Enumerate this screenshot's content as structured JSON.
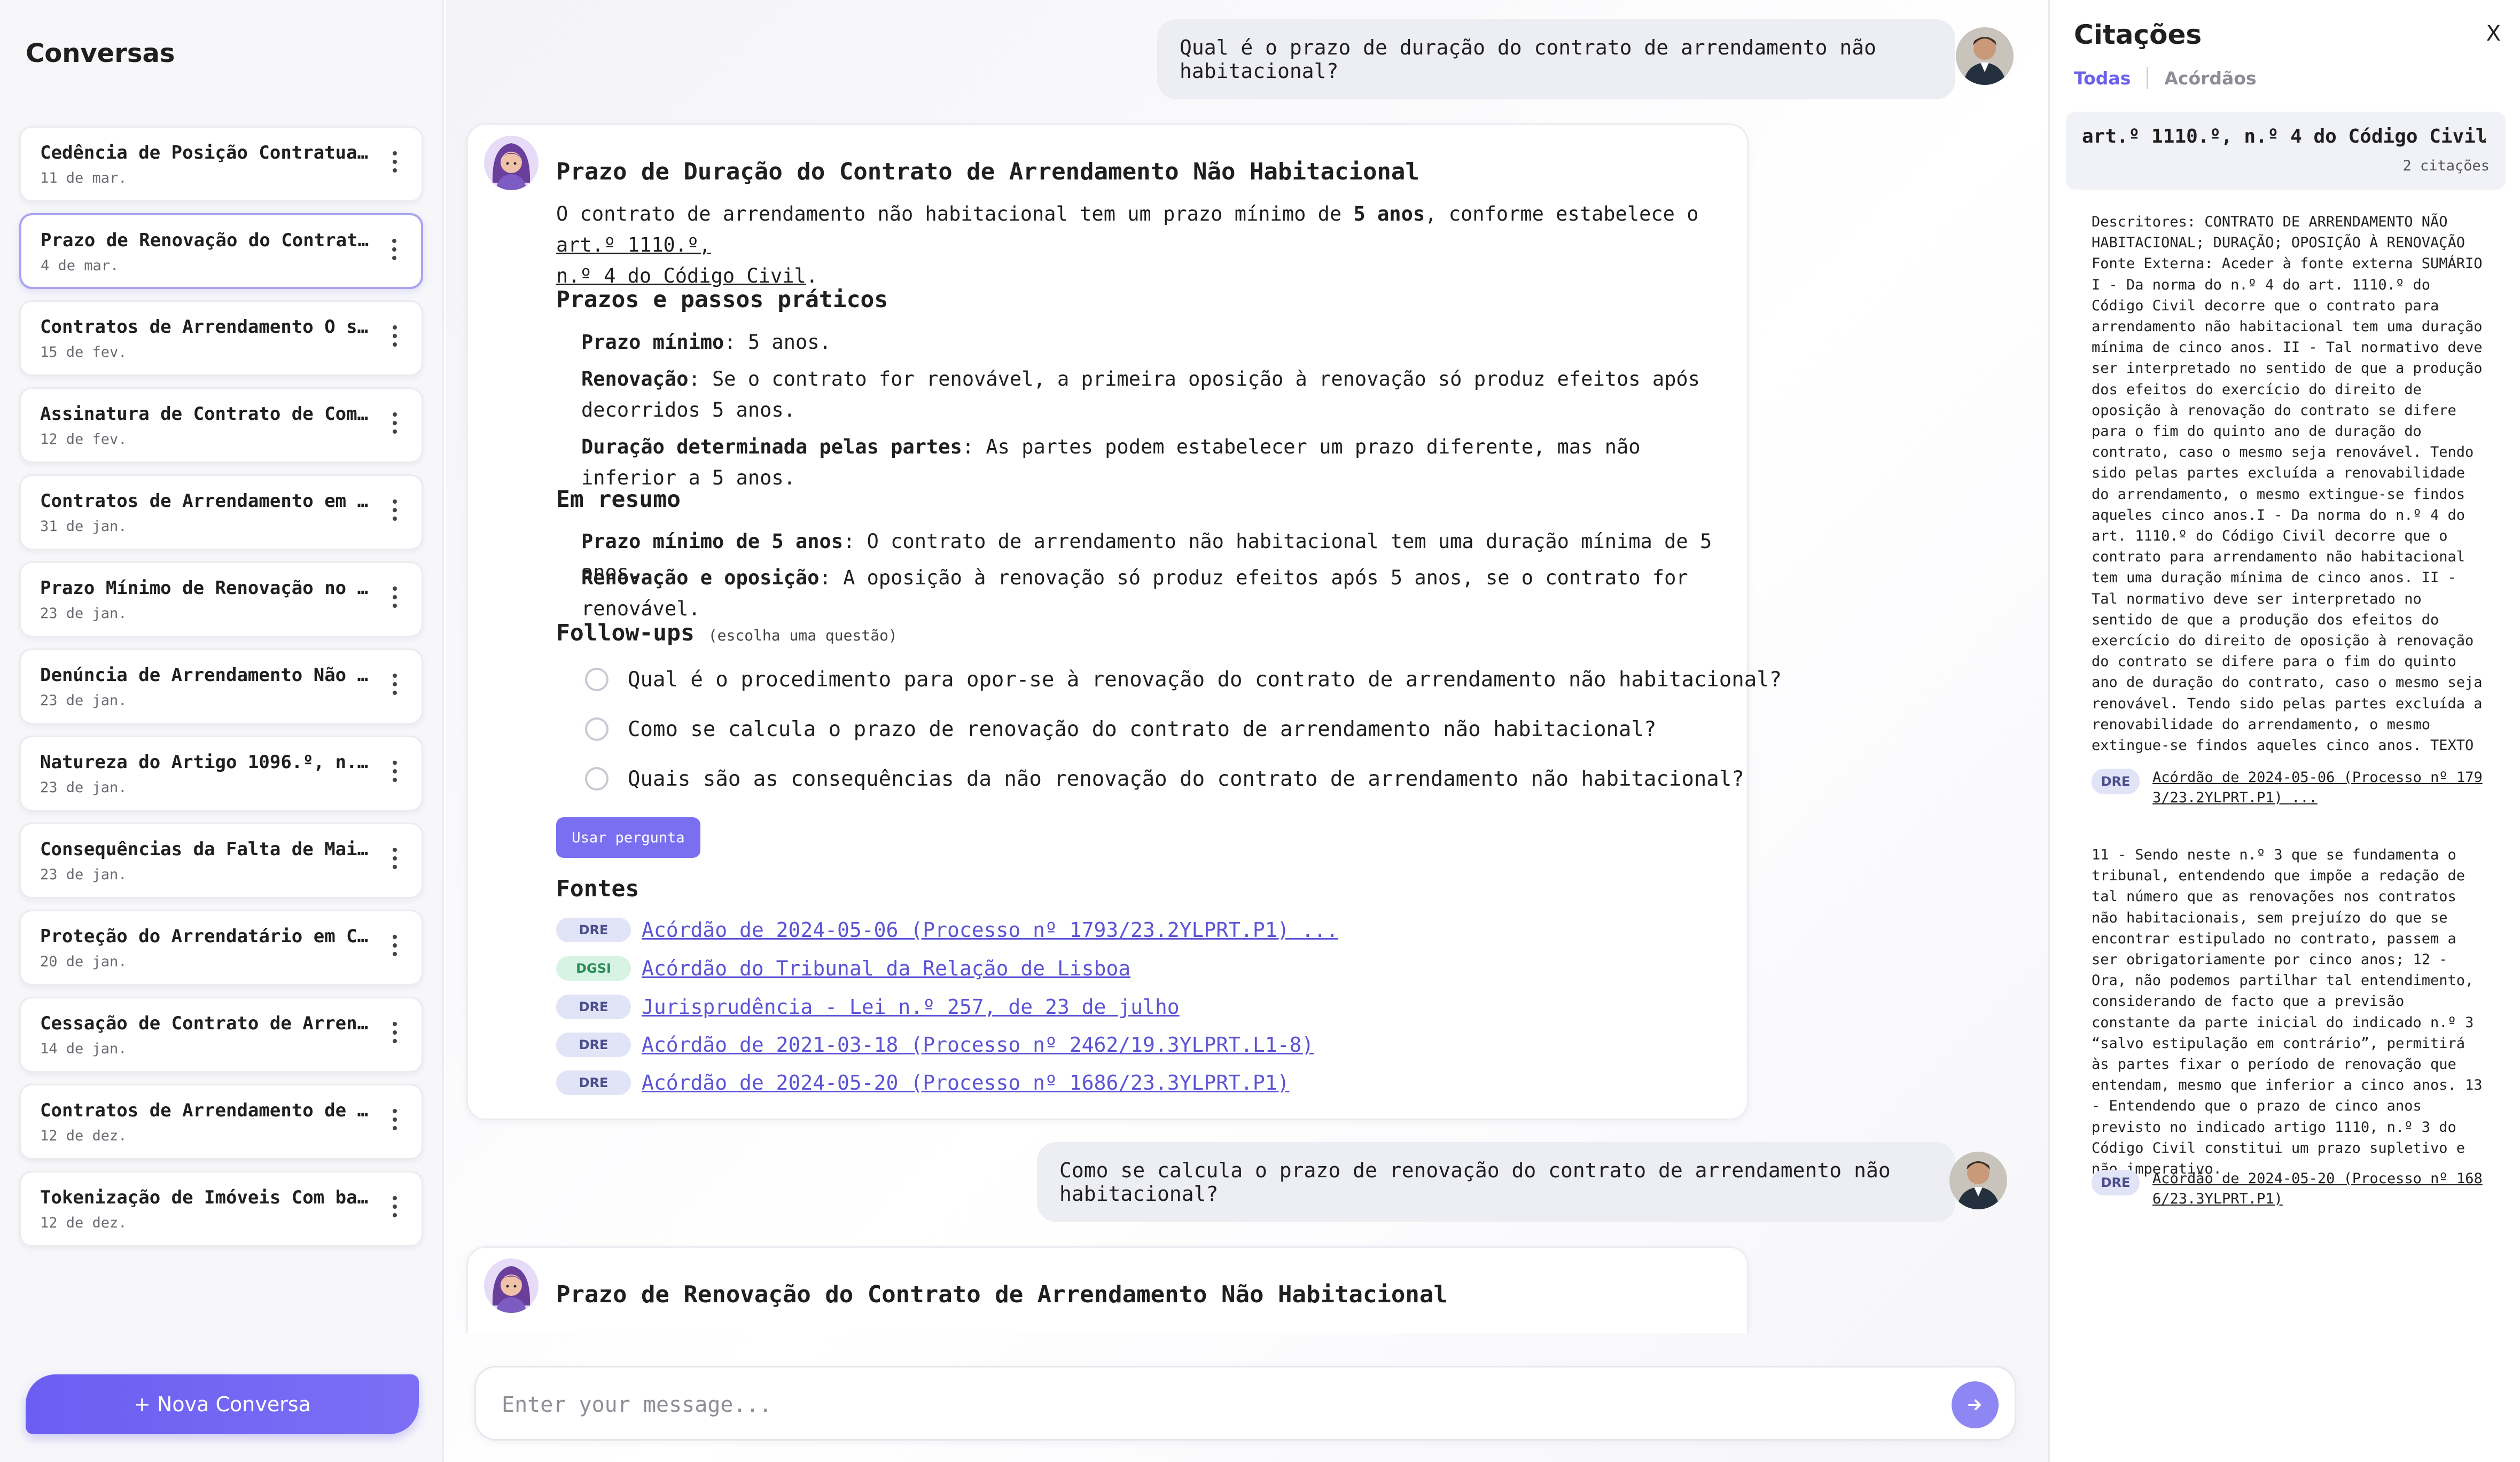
{
  "sidebar": {
    "title": "Conversas",
    "conversations": [
      {
        "title": "Cedência de Posição Contratual ...",
        "date": "11 de mar."
      },
      {
        "title": "Prazo de Renovação do Contrato ...",
        "date": "4 de mar."
      },
      {
        "title": "Contratos de Arrendamento O se...",
        "date": "15 de fev."
      },
      {
        "title": "Assinatura de Contrato de Comp...",
        "date": "12 de fev."
      },
      {
        "title": "Contratos de Arrendamento em P...",
        "date": "31 de jan."
      },
      {
        "title": "Prazo Mínimo de Renovação no A...",
        "date": "23 de jan."
      },
      {
        "title": "Denúncia de Arrendamento Não ...",
        "date": "23 de jan."
      },
      {
        "title": "Natureza do Artigo 1096.º, n.º 1,...",
        "date": "23 de jan."
      },
      {
        "title": "Consequências da Falta de Maior...",
        "date": "23 de jan."
      },
      {
        "title": "Proteção do Arrendatário em Co...",
        "date": "20 de jan."
      },
      {
        "title": "Cessação de Contrato de Arrend...",
        "date": "14 de jan."
      },
      {
        "title": "Contratos de Arrendamento de 2 ...",
        "date": "12 de dez."
      },
      {
        "title": "Tokenização de Imóveis Com bas...",
        "date": "12 de dez."
      }
    ],
    "new_conversation": "+ Nova Conversa"
  },
  "chat": {
    "user_q1": "Qual é o prazo de duração do contrato de arrendamento não habitacional?",
    "resp1": {
      "title": "Prazo de Duração do Contrato de Arrendamento Não Habitacional",
      "intro_a": "O contrato de arrendamento não habitacional tem um prazo mínimo de ",
      "intro_bold": "5 anos",
      "intro_b": ", conforme estabelece o ",
      "intro_link": "art.º 1110.º,",
      "intro_link2": "n.º 4 do Código Civil",
      "intro_end": ".",
      "section1_title": "Prazos e passos práticos",
      "section1_items": [
        {
          "label": "Prazo mínimo",
          "text": ": 5 anos."
        },
        {
          "label": "Renovação",
          "text": ": Se o contrato for renovável, a primeira oposição à renovação só produz efeitos após decorridos 5 anos."
        },
        {
          "label": "Duração determinada pelas partes",
          "text": ": As partes podem estabelecer um prazo diferente, mas não inferior a 5 anos."
        }
      ],
      "section2_title": "Em resumo",
      "section2_items": [
        {
          "label": "Prazo mínimo de 5 anos",
          "text": ": O contrato de arrendamento não habitacional tem uma duração mínima de 5 anos."
        },
        {
          "label": "Renovação e oposição",
          "text": ": A oposição à renovação só produz efeitos após 5 anos, se o contrato for renovável."
        }
      ],
      "followups_title": "Follow-ups",
      "followups_hint": "(escolha uma questão)",
      "followups": [
        "Qual é o procedimento para opor-se à renovação do contrato de arrendamento não habitacional?",
        "Como se calcula o prazo de renovação do contrato de arrendamento não habitacional?",
        "Quais são as consequências da não renovação do contrato de arrendamento não habitacional?"
      ],
      "use_question": "Usar pergunta",
      "sources_title": "Fontes",
      "sources": [
        {
          "badge": "DRE",
          "text": "Acórdão de 2024-05-06 (Processo nº 1793/23.2YLPRT.P1) ..."
        },
        {
          "badge": "DGSI",
          "text": "Acórdão do Tribunal da Relação de Lisboa"
        },
        {
          "badge": "DRE",
          "text": "Jurisprudência - Lei n.º 257, de 23 de julho"
        },
        {
          "badge": "DRE",
          "text": "Acórdão de 2021-03-18 (Processo nº 2462/19.3YLPRT.L1-8)"
        },
        {
          "badge": "DRE",
          "text": "Acórdão de 2024-05-20 (Processo nº 1686/23.3YLPRT.P1)"
        }
      ]
    },
    "user_q2": "Como se calcula o prazo de renovação do contrato de arrendamento não habitacional?",
    "resp2": {
      "title": "Prazo de Renovação do Contrato de Arrendamento Não Habitacional"
    },
    "input_placeholder": "Enter your message..."
  },
  "panel": {
    "title": "Citações",
    "close": "X",
    "tab_all": "Todas",
    "tab_acordaos": "Acórdãos",
    "citation_title": "art.º 1110.º, n.º 4 do Código Civil",
    "citation_count": "2 citações",
    "chevron": "⌄",
    "excerpt1": "Descritores: CONTRATO DE ARRENDAMENTO NÃO HABITACIONAL; DURAÇÃO; OPOSIÇÃO À RENOVAÇÃO Fonte Externa: Aceder à fonte externa SUMÁRIO I - Da norma do n.º 4 do art. 1110.º do Código Civil decorre que o contrato para arrendamento não habitacional tem uma duração mínima de cinco anos. II - Tal normativo deve ser interpretado no sentido de que a produção dos efeitos do exercício do direito de oposição à renovação do contrato se difere para o fim do quinto ano de duração do contrato, caso o mesmo seja renovável. Tendo sido pelas partes excluída a renovabilidade do arrendamento, o mesmo extingue-se findos aqueles cinco anos.I - Da norma do n.º 4 do art. 1110.º do Código Civil decorre que o contrato para arrendamento não habitacional tem uma duração mínima de cinco anos. II - Tal normativo deve ser interpretado no sentido de que a produção dos efeitos do exercício do direito de oposição à renovação do contrato se difere para o fim do quinto ano de duração do contrato, caso o mesmo seja renovável. Tendo sido pelas partes excluída a renovabilidade do arrendamento, o mesmo extingue-se findos aqueles cinco anos. TEXTO",
    "ref1_badge": "DRE",
    "ref1_link": "Acórdão de 2024-05-06 (Processo nº 179 3/23.2YLPRT.P1) ...",
    "excerpt2": "11 - Sendo neste n.º 3 que se fundamenta o tribunal, entendendo que impõe a redação de tal número que as renovações nos contratos não habitacionais, sem prejuízo do que se encontrar estipulado no contrato, passem a ser obrigatoriamente por cinco anos; 12 - Ora, não podemos partilhar tal entendimento, considerando de facto que a previsão constante da parte inicial do indicado n.º 3 “salvo estipulação em contrário”, permitirá às partes fixar o período de renovação que entendam, mesmo que inferior a cinco anos. 13 - Entendendo que o prazo de cinco anos previsto no indicado artigo 1110, n.º 3 do Código Civil constitui um prazo supletivo e não imperativo.",
    "ref2_badge": "DRE",
    "ref2_link": "Acórdão de 2024-05-20 (Processo nº 168 6/23.3YLPRT.P1)"
  },
  "colors": {
    "accent": "#6b5ef2",
    "link": "#5b53d6",
    "badge_dre": "#e1e4f7",
    "badge_dgsi": "#d6f3e3"
  },
  "icons": [
    "kebab-menu-icon",
    "assistant-avatar",
    "user-avatar",
    "send-arrow-icon",
    "radio-icon",
    "chevron-down-icon",
    "close-icon"
  ]
}
